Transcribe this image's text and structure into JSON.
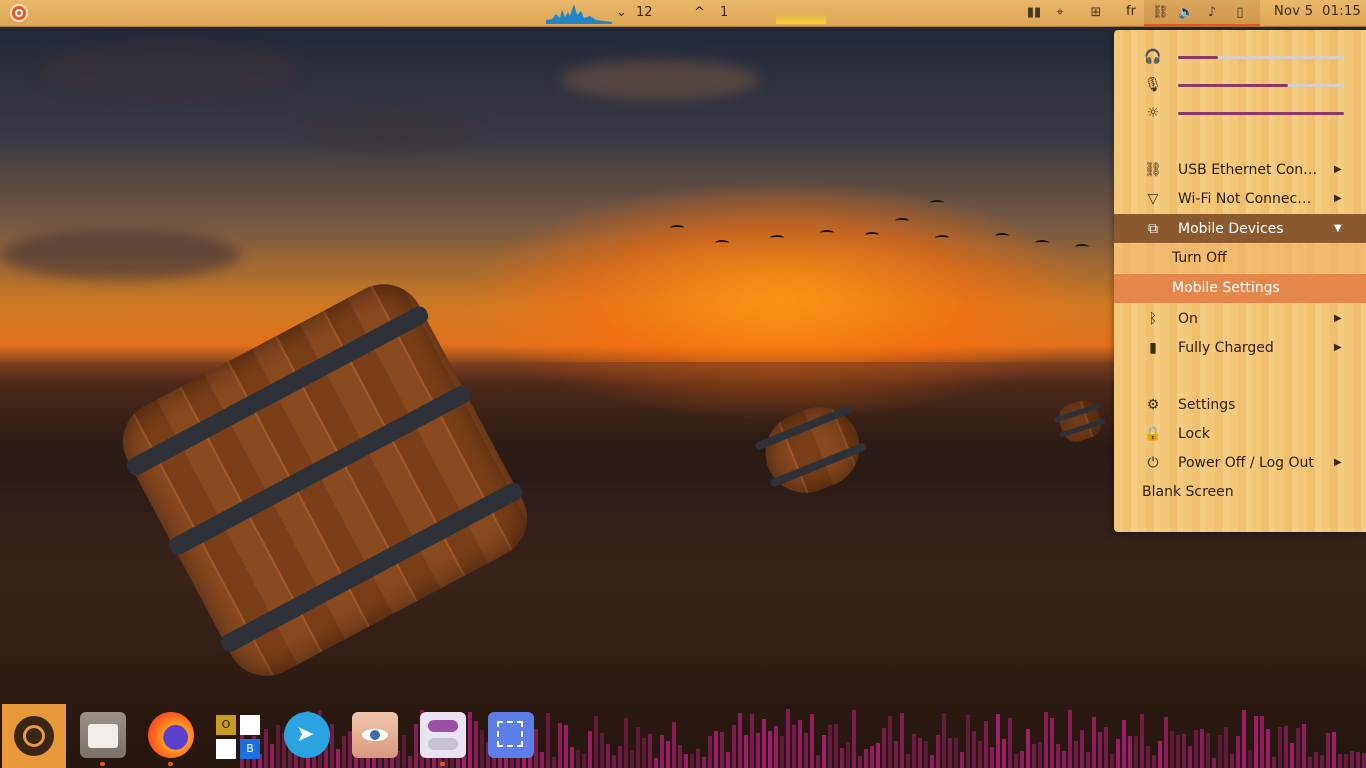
{
  "top_panel": {
    "net_down": "12",
    "net_up": "1",
    "arrow_down": "⌄",
    "arrow_up": "^",
    "language": "fr",
    "clock_date": "Nov 5",
    "clock_time": "01:15"
  },
  "system_menu": {
    "sliders": [
      {
        "icon": "headphones-icon",
        "level": 0.24
      },
      {
        "icon": "microphone-icon",
        "level": 0.66
      },
      {
        "icon": "brightness-icon",
        "level": 1.0
      }
    ],
    "items": {
      "usb_ethernet": "USB Ethernet Con…",
      "wifi": "Wi-Fi Not Connec…",
      "mobile_devices": "Mobile Devices",
      "turn_off": "Turn Off",
      "mobile_settings": "Mobile Settings",
      "bluetooth": "On",
      "battery": "Fully Charged",
      "settings": "Settings",
      "lock": "Lock",
      "power": "Power Off / Log Out",
      "blank_screen": "Blank Screen"
    }
  },
  "dock": {
    "apps": [
      {
        "name": "show-applications",
        "color": "#e8561f"
      },
      {
        "name": "files",
        "color": "#d0cbc4"
      },
      {
        "name": "firefox",
        "color": "#ff7a1a"
      },
      {
        "name": "office-app",
        "color": "#ffffff"
      },
      {
        "name": "telegram",
        "color": "#2aa3e0"
      },
      {
        "name": "eye-app",
        "color": "#e8b49a"
      },
      {
        "name": "tweaks",
        "color": "#e9e4f0"
      },
      {
        "name": "screenshot",
        "color": "#5d7ee6"
      }
    ],
    "office_letters": [
      "O",
      "B"
    ]
  },
  "colors": {
    "accent": "#e8561f",
    "menu_expanded": "#8a5a2e",
    "menu_hover": "#e4874a",
    "slider_fill": "#8a3a6a",
    "visualizer": "#b8207c"
  }
}
